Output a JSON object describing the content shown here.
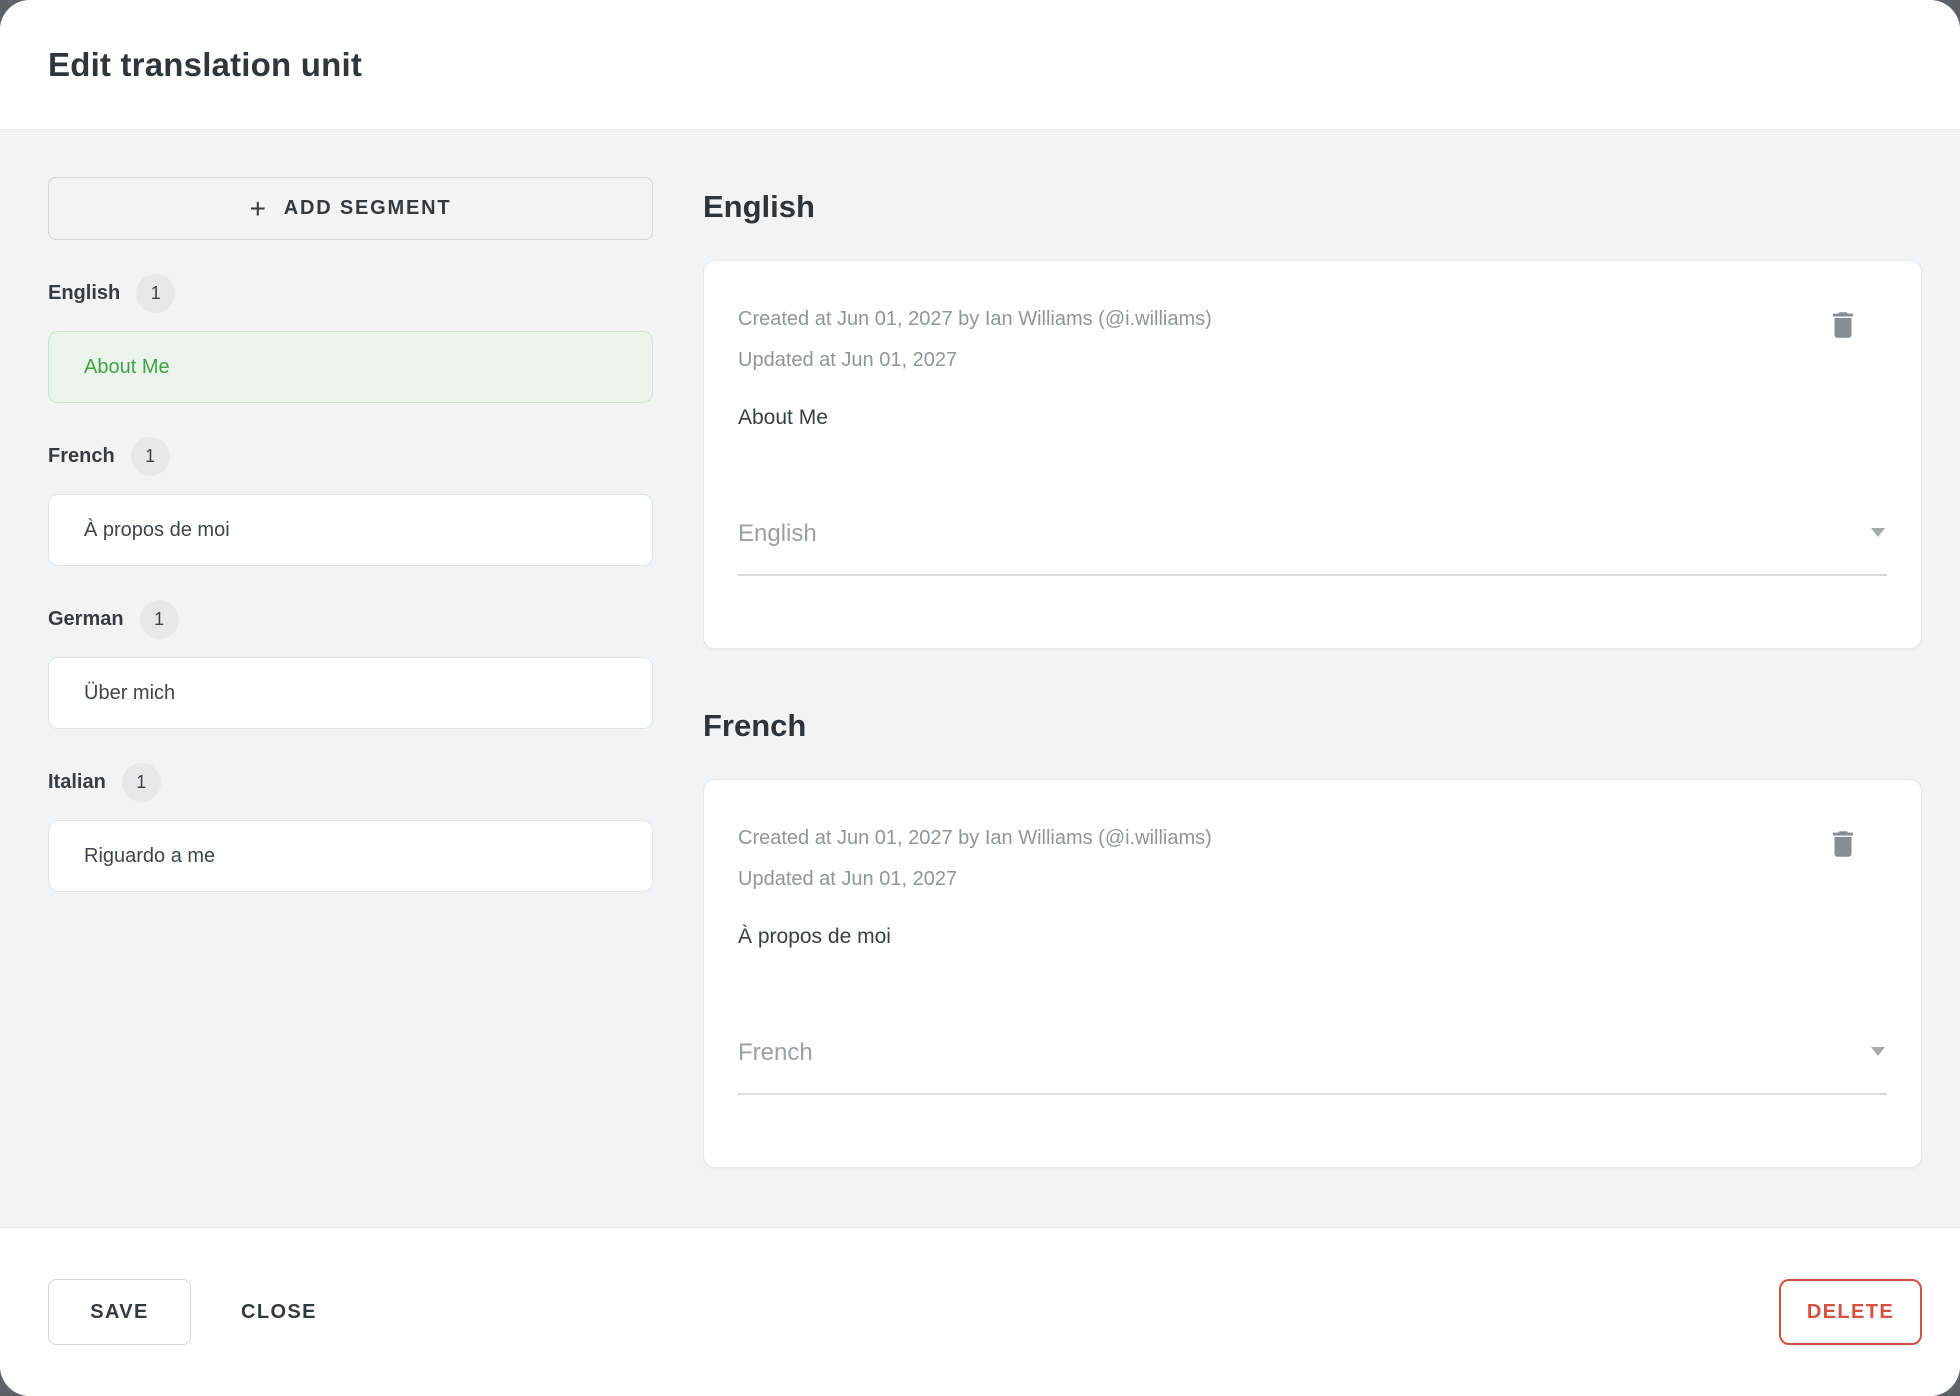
{
  "dialog": {
    "title": "Edit translation unit"
  },
  "sidebar": {
    "add_segment_label": "ADD SEGMENT",
    "plus_icon": "+",
    "groups": [
      {
        "language": "English",
        "count": "1",
        "segment": "About Me",
        "active": true
      },
      {
        "language": "French",
        "count": "1",
        "segment": "À propos de moi",
        "active": false
      },
      {
        "language": "German",
        "count": "1",
        "segment": "Über mich",
        "active": false
      },
      {
        "language": "Italian",
        "count": "1",
        "segment": "Riguardo a me",
        "active": false
      }
    ]
  },
  "main": {
    "sections": [
      {
        "heading": "English",
        "created_line": "Created at Jun 01, 2027 by Ian Williams (@i.williams)",
        "updated_line": "Updated at Jun 01, 2027",
        "content": "About Me",
        "language_select_value": "English"
      },
      {
        "heading": "French",
        "created_line": "Created at Jun 01, 2027 by Ian Williams (@i.williams)",
        "updated_line": "Updated at Jun 01, 2027",
        "content": "À propos de moi",
        "language_select_value": "French"
      }
    ]
  },
  "footer": {
    "save_label": "SAVE",
    "close_label": "CLOSE",
    "delete_label": "DELETE"
  },
  "icons": {
    "plus-icon": "+",
    "trash-icon": "trash-can glyph (svg)",
    "chevron-down-icon": "▼"
  },
  "colors": {
    "accent_green_text": "#43a047",
    "accent_green_bg": "#eaf4ea",
    "accent_green_border": "#cfe3cf",
    "danger_red": "#d5503e",
    "backdrop": "#5c6268",
    "body_bg": "#f1f3f5",
    "meta_gray": "#8f959a"
  }
}
